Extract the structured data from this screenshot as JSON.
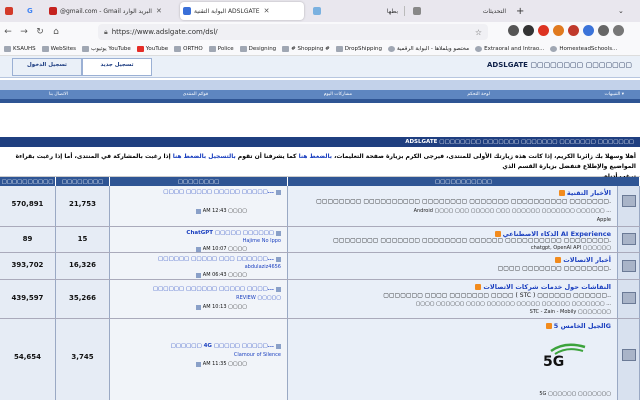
{
  "tabs": [
    {
      "label": "",
      "color": "#d33a2a"
    },
    {
      "label": "G",
      "color": "#4285f4"
    },
    {
      "label": "@gmail.com - Gmail البريد الوارد",
      "color": "#c5221f"
    },
    {
      "label": "البوابة التقنية ADSLGATE",
      "color": "#3a6fd8"
    },
    {
      "label": "بطها",
      "color": "#7ab1e0"
    },
    {
      "label": "التحديثات",
      "color": "#888888"
    }
  ],
  "browser": {
    "url": "https://www.adslgate.com/dsl/",
    "new_tab": "+"
  },
  "bookmarks": [
    "KSAUHS",
    "WebSites",
    "يوتيوب YouTube",
    "YouTube",
    "ORTHO",
    "Police",
    "Designing",
    "# Shopping #",
    "DropShipping",
    "مختصو ويلملاها - البوابة الرقمية",
    "Extraoral and Intrao...",
    "HomesteadSchools..."
  ],
  "header": {
    "site_name": "ADSLGATE ▢▢▢▢▢▢▢▢ ▢▢▢▢▢▢▢",
    "login_tab": "تسجيل الدخول",
    "register_tab": "تسجيل جديد"
  },
  "nav": {
    "alerts": "التنبيهات ▾",
    "control_panel": "لوحة التحكم",
    "today_posts": "مشاركات اليوم",
    "forum_list": "قوائم المنتدى",
    "contact": "الاتصال بنا"
  },
  "breadcrumb": "ADSLGATE ▢▢▢▢▢▢▢▢ ▢▢▢▢▢▢▢ ▢▢▢▢▢▢▢ ▢▢▢▢▢▢▢ ▢▢▢▢▢▢▢",
  "welcome": {
    "line1_a": "أهلا وسهلا بك زائرنا الكريم، إذا كانت هذه زيارتك الأولى للمنتدى، فيرجى الكرم بزيارة صفحة التعليمات،",
    "link_faq": "بالضغط هنا",
    "line1_b": "كما يشرفنا أن تقوم",
    "link_register": "بالتسجيل بالضغط هنا",
    "line1_c": "إذا رغبت بالمشاركة في المنتدى، أما إذا رغبت بقراءة المواضيع والإطلاع فتفضل بزيارة القسم الذي",
    "line2": "ترغب أدناه."
  },
  "table": {
    "headers": [
      "▢▢▢▢▢▢▢▢▢▢",
      "▢▢▢▢▢▢▢▢",
      "▢▢▢▢▢▢▢▢",
      "▢▢▢▢▢▢▢▢▢▢▢"
    ],
    "rows": [
      {
        "forum": "الأخبار التقنية",
        "desc": "▢▢▢▢▢▢▢▢ ▢▢▢▢▢▢▢▢▢▢ ▢▢▢▢▢▢▢▢ ▢▢▢▢▢▢▢ ▢▢▢▢▢▢▢▢▢▢ ▢▢▢▢▢▢▢.",
        "sub": "Android ▢▢▢▢ ▢▢▢ ▢▢▢▢▢ ▢▢▢ ▢▢▢▢▢▢ ▢▢▢▢▢▢▢ ▢▢▢▢▢▢ ...",
        "sub2": "Apple",
        "last_title": "▢▢▢▢ ▢▢▢▢▢ ▢▢▢▢▢ ▢▢▢▢▢...",
        "last_user": "",
        "last_date": "AM 12:43 ▢▢▢▢",
        "posts": "21,753",
        "count": "570,891"
      },
      {
        "forum": "الذكاء الاصطناعي AI Experience",
        "desc": "▢▢▢▢▢▢▢▢ ▢▢▢▢▢▢▢ ▢▢▢▢▢▢▢▢ ▢▢▢▢▢▢ ▢▢▢▢▢▢▢▢▢▢ ▢▢▢▢▢▢▢▢.",
        "sub": "chatgpt, OpenAI API ▢▢▢▢▢▢",
        "sub2": "",
        "last_title": "ChatGPT ▢▢▢▢▢ ▢▢▢▢▢▢",
        "last_user": "Hajime No Ippo",
        "last_date": "AM 10:07 ▢▢▢▢",
        "posts": "15",
        "count": "89"
      },
      {
        "forum": "أخبار الاتصالات",
        "desc": "▢▢▢▢ ▢▢▢▢▢▢▢ ▢▢▢▢▢▢▢▢.",
        "sub": "",
        "sub2": "",
        "last_title": "▢▢▢▢▢▢ ▢▢▢▢▢ ▢▢▢ ▢▢▢▢▢▢...",
        "last_user": "abdulaziz4656",
        "last_date": "AM 06:43 ▢▢▢▢",
        "posts": "16,326",
        "count": "393,702"
      },
      {
        "forum": "النقاشات حول خدمات شركات الاتصالات",
        "desc": "▢▢▢▢▢▢▢ ▢▢▢▢ ▢▢▢▢▢▢▢ ▢▢▢▢ ( STC ) ▢▢▢▢▢▢ ▢▢▢▢▢▢..",
        "sub": "▢▢▢▢ ▢▢▢▢▢▢ ▢▢▢▢ ▢▢▢▢▢▢ ▢▢▢▢▢ ▢▢▢▢▢▢ ▢▢▢▢▢▢▢ ...",
        "sub2": "STC - Zain - Mobily ▢▢▢▢▢▢▢",
        "last_title": "▢▢▢▢▢▢ ▢▢▢▢▢▢ ▢▢▢▢▢ ▢▢▢▢...",
        "last_user": "REVIEW ▢▢▢▢▢",
        "last_date": "AM 10:13 ▢▢▢▢",
        "posts": "35,266",
        "count": "439,597"
      },
      {
        "forum": "الجيل الخامس 5G",
        "desc": "",
        "sub": "",
        "sub2": "5G ▢▢▢▢▢▢ ▢▢▢▢▢▢▢",
        "last_title": "▢▢▢▢▢▢ 4G ▢▢▢▢▢ ▢▢▢▢▢...",
        "last_user": "Clamour of Silence",
        "last_date": "AM 11:35 ▢▢▢▢",
        "posts": "3,745",
        "count": "54,654"
      }
    ]
  }
}
